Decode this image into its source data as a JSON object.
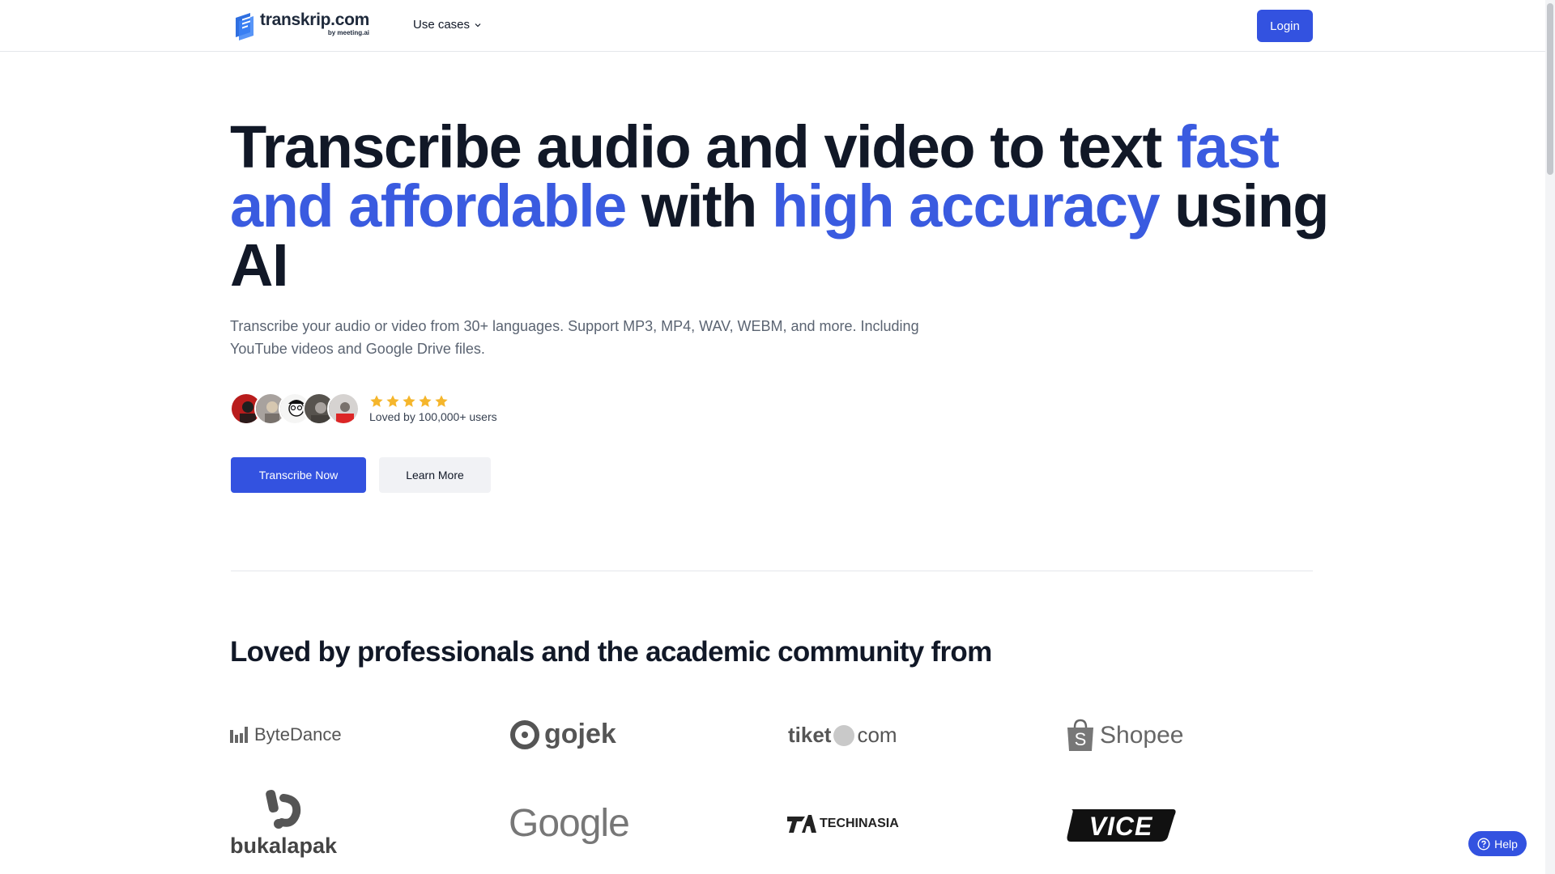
{
  "header": {
    "logo_name": "transkrip.com",
    "logo_by": "by meeting.ai",
    "nav_use_cases": "Use cases",
    "login_label": "Login"
  },
  "hero": {
    "title_parts": [
      "Transcribe audio and video to text ",
      "fast and affordable",
      " with ",
      "high accuracy",
      " using AI"
    ],
    "subtitle": "Transcribe your audio or video from 30+ languages. Support MP3, MP4, WAV, WEBM, and more. Including YouTube videos and Google Drive files.",
    "rating_stars": 5,
    "loved_by": "Loved by 100,000+ users",
    "primary_cta": "Transcribe Now",
    "secondary_cta": "Learn More"
  },
  "logos_section": {
    "title": "Loved by professionals and the academic community from",
    "logos": {
      "bytedance": "ByteDance",
      "gojek": "gojek",
      "tiket_left": "tiket",
      "tiket_right": "com",
      "shopee": "Shopee",
      "bukalapak": "bukalapak",
      "google": "Google",
      "techinasia": "TECHINASIA",
      "vice": "VICE"
    }
  },
  "help": {
    "label": "Help"
  },
  "colors": {
    "accent": "#3352e0",
    "highlight_text": "#3a5be0",
    "star": "#f5b62c"
  }
}
